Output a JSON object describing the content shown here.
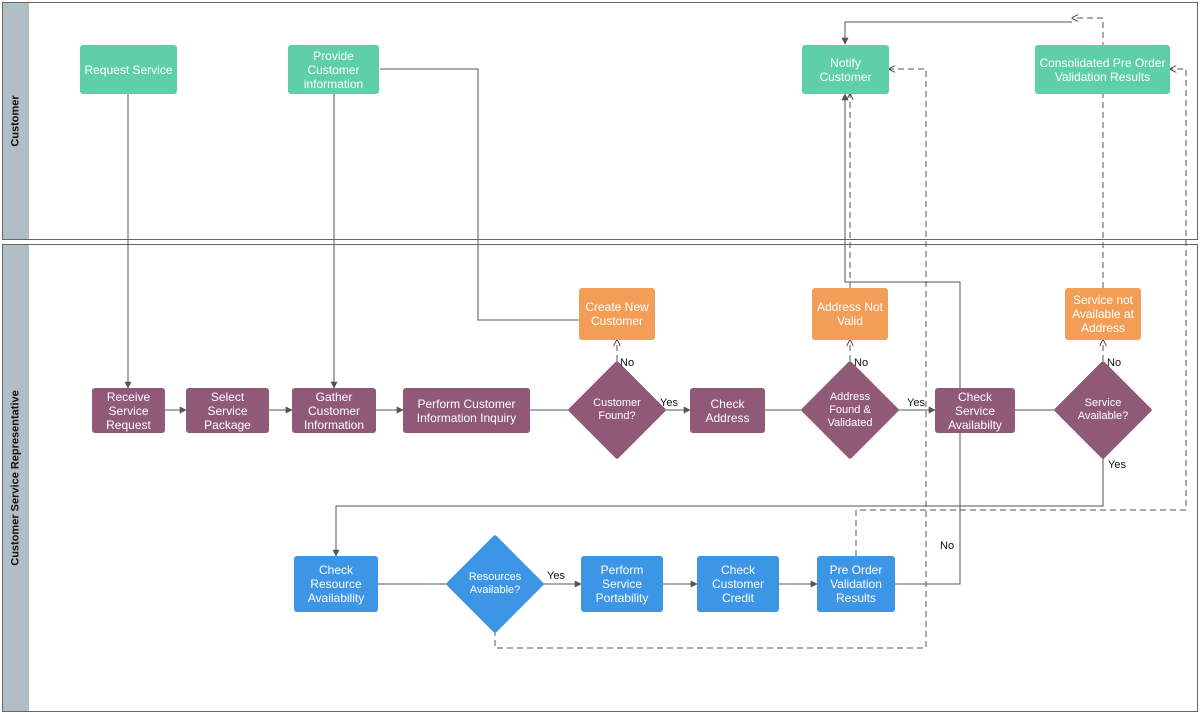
{
  "lanes": {
    "customer": "Customer",
    "csr": "Customer Service Representative"
  },
  "nodes": {
    "request_service": "Request Service",
    "provide_info": "Provide Customer information",
    "notify_customer": "Notify Customer",
    "consolidated": "Consolidated Pre Order Validation Results",
    "receive_request": "Receive Service Request",
    "select_package": "Select Service Package",
    "gather_info": "Gather Customer Information",
    "perform_inquiry": "Perform Customer Information Inquiry",
    "create_customer": "Create New Customer",
    "customer_found": "Customer Found?",
    "check_address": "Check Address",
    "addr_not_valid": "Address Not Valid",
    "addr_validated": "Address Found & Validated",
    "check_service": "Check Service Availabilty",
    "svc_not_avail": "Service not Available at Address",
    "svc_available": "Service Available?",
    "check_resource": "Check Resource Availability",
    "res_available": "Resources Available?",
    "perform_port": "Perform Service Portability",
    "check_credit": "Check Customer Credit",
    "pre_order": "Pre Order Validation Results"
  },
  "labels": {
    "yes": "Yes",
    "no": "No"
  },
  "colors": {
    "green": "#5FCFA9",
    "purple": "#8F5977",
    "orange": "#F29E57",
    "blue": "#3D95E5"
  }
}
